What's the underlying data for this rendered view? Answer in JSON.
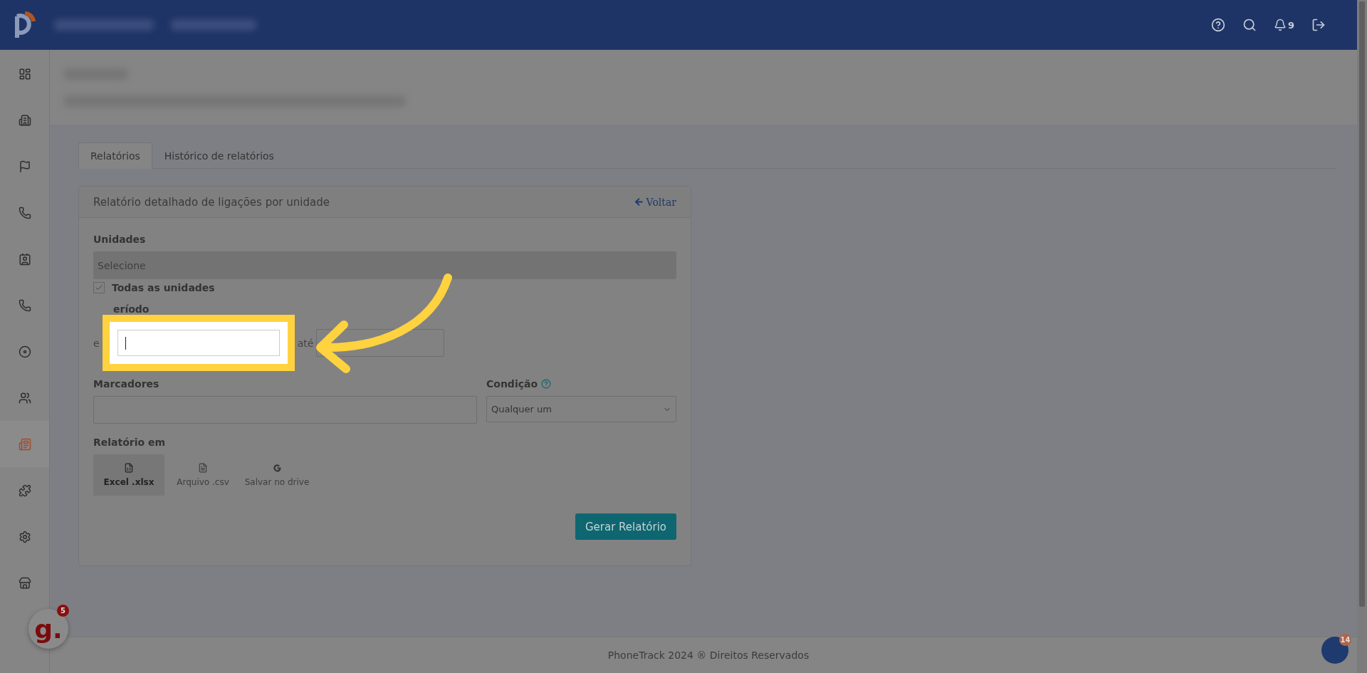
{
  "topbar": {
    "notification_count": "9"
  },
  "sidebar": {
    "items": [
      {
        "selected": false
      },
      {
        "selected": false
      },
      {
        "selected": false
      },
      {
        "selected": false
      },
      {
        "selected": false
      },
      {
        "selected": false
      },
      {
        "selected": false
      },
      {
        "selected": false
      },
      {
        "selected": true
      },
      {
        "selected": false
      },
      {
        "selected": false
      },
      {
        "selected": false
      }
    ]
  },
  "tabs": [
    {
      "label": "Relatórios",
      "selected": true
    },
    {
      "label": "Histórico de relatórios",
      "selected": false
    }
  ],
  "panel": {
    "title": "Relatório detalhado de ligações por unidade",
    "back_link": "Voltar",
    "units": {
      "label": "Unidades",
      "placeholder": "Selecione",
      "all_units": {
        "label": "Todas as unidades",
        "checked": true
      }
    },
    "period": {
      "label": "eríodo",
      "from_label": "e",
      "to_label": "até"
    },
    "markers": {
      "label": "Marcadores"
    },
    "condition": {
      "label": "Condição",
      "value": "Qualquer um"
    },
    "report_format": {
      "label": "Relatório em",
      "options": [
        {
          "label": "Excel .xlsx",
          "selected": true
        },
        {
          "label": "Arquivo .csv",
          "selected": false
        },
        {
          "label": "Salvar no drive",
          "selected": false
        }
      ]
    },
    "submit": "Gerar Relatório"
  },
  "footer": "PhoneTrack 2024 ® Direitos Reservados",
  "chat_widget": {
    "logo": "g.",
    "badge": "5"
  },
  "help_widget": {
    "badge": "14"
  }
}
